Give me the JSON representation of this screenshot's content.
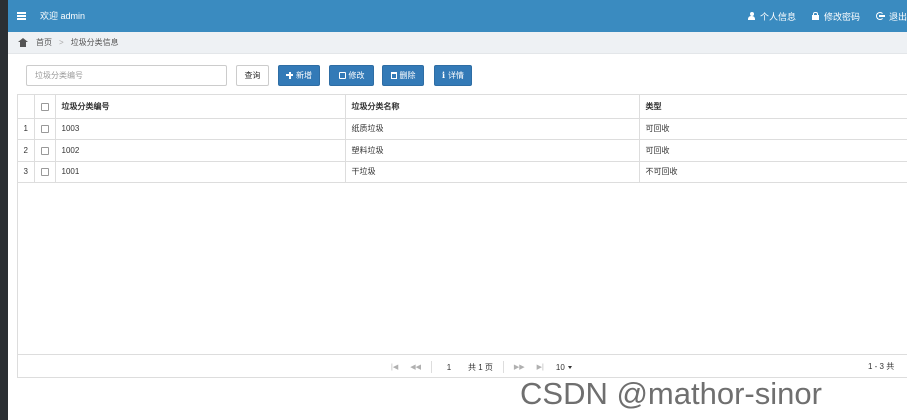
{
  "header": {
    "welcome": "欢迎 admin",
    "nav": {
      "profile": "个人信息",
      "password": "修改密码",
      "logout": "退出"
    }
  },
  "breadcrumb": {
    "home": "首页",
    "current": "垃圾分类信息"
  },
  "toolbar": {
    "search_placeholder": "垃圾分类编号",
    "search_value": "",
    "query_label": "查询",
    "add_label": "新增",
    "edit_label": "修改",
    "delete_label": "删除",
    "detail_label": "详情"
  },
  "table": {
    "columns": [
      "垃圾分类编号",
      "垃圾分类名称",
      "类型"
    ],
    "rows": [
      {
        "index": "1",
        "code": "1003",
        "name": "纸质垃圾",
        "type": "可回收"
      },
      {
        "index": "2",
        "code": "1002",
        "name": "塑料垃圾",
        "type": "可回收"
      },
      {
        "index": "3",
        "code": "1001",
        "name": "干垃圾",
        "type": "不可回收"
      }
    ]
  },
  "pager": {
    "page_value": "1",
    "total_pages": "共 1 页",
    "page_size": "10",
    "summary": "1 - 3   共"
  },
  "watermark": "CSDN @mathor-sinor"
}
